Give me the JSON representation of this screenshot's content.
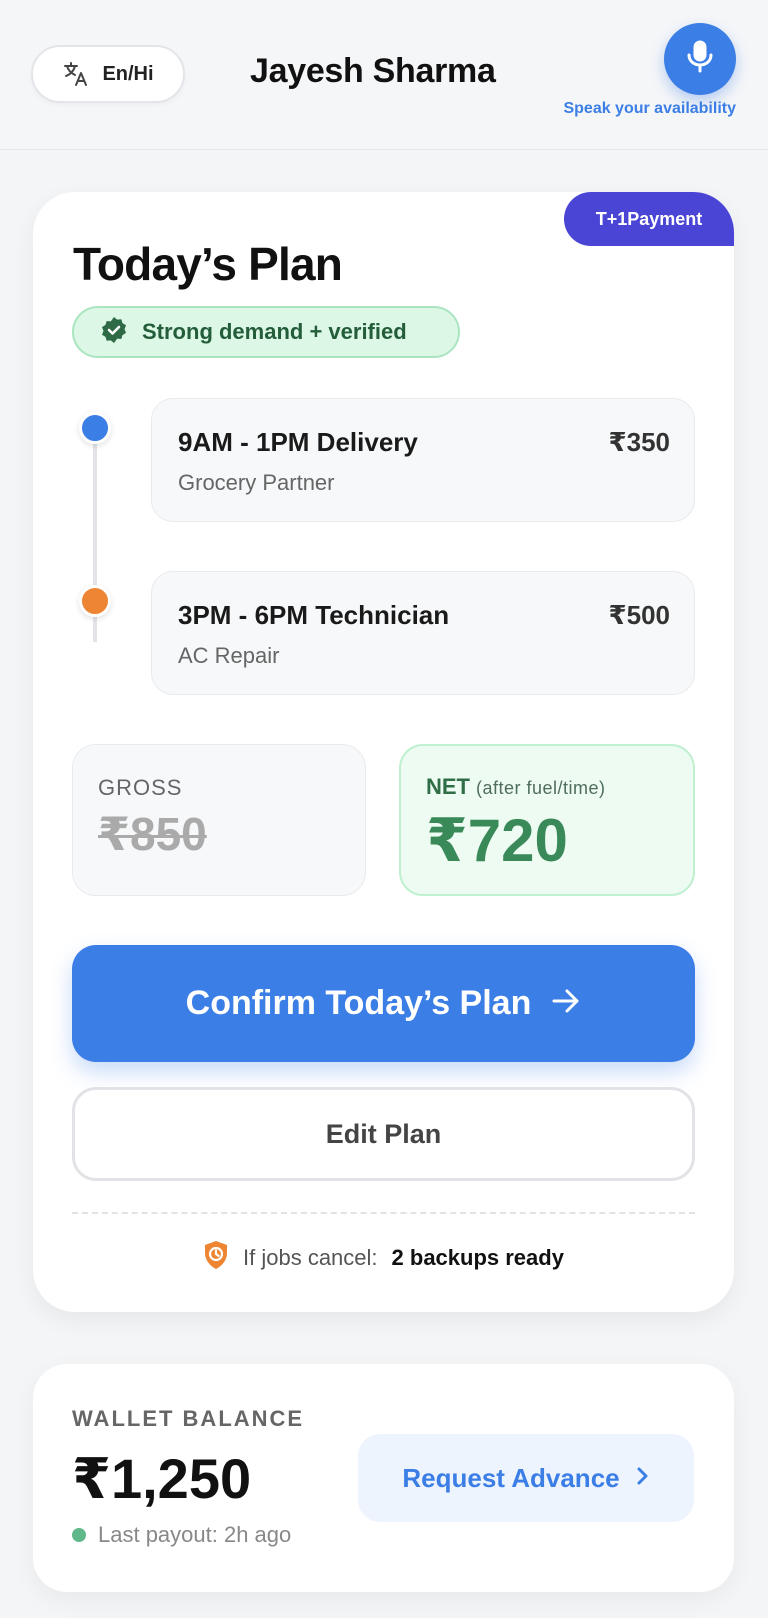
{
  "header": {
    "language_toggle": "En/Hi",
    "user_name": "Jayesh Sharma",
    "voice_caption": "Speak your availability"
  },
  "plan": {
    "payment_badge": "T+1Payment",
    "title": "Today’s Plan",
    "demand_badge": "Strong demand + verified",
    "jobs": [
      {
        "title": "9AM - 1PM Delivery",
        "subtitle": "Grocery Partner",
        "price": "₹350",
        "color": "#3b7ee6"
      },
      {
        "title": "3PM - 6PM Technician",
        "subtitle": "AC Repair",
        "price": "₹500",
        "color": "#ee8533"
      }
    ],
    "gross": {
      "label": "GROSS",
      "value": "₹850"
    },
    "net": {
      "label": "NET",
      "note": "(after fuel/time)",
      "value": "₹720"
    },
    "confirm_label": "Confirm Today’s Plan",
    "edit_label": "Edit Plan",
    "backup": {
      "prefix": "If jobs cancel:",
      "strong": "2 backups ready"
    }
  },
  "wallet": {
    "label": "WALLET BALANCE",
    "amount": "₹1,250",
    "last_payout": "Last payout: 2h ago",
    "advance_label": "Request Advance"
  },
  "colors": {
    "accent": "#3b7ee6",
    "payment_badge": "#4b45d6",
    "success": "#3a8a59",
    "warning": "#ee8533"
  },
  "icons": {
    "language": "translate-icon",
    "mic": "microphone-icon",
    "verified": "verified-badge-icon",
    "arrow": "arrow-right-icon",
    "shield": "shield-clock-icon",
    "chevron": "chevron-right-icon"
  }
}
